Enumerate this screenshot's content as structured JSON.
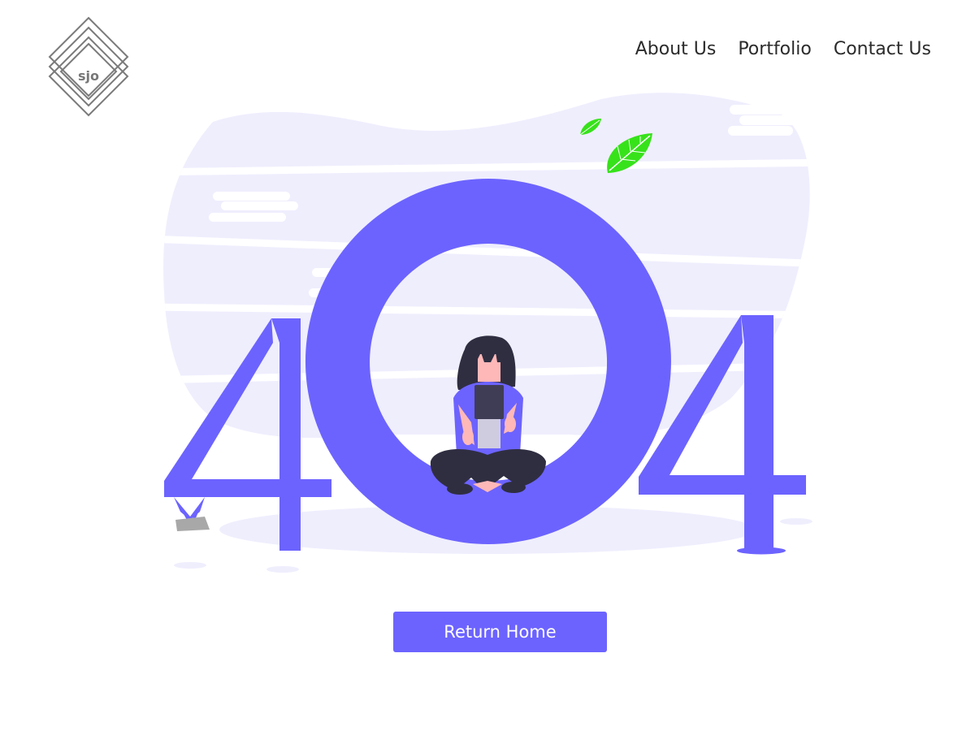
{
  "logo": {
    "text": "sjo",
    "icon": "diamond-logo-icon"
  },
  "nav": {
    "items": [
      {
        "label": "About Us"
      },
      {
        "label": "Portfolio"
      },
      {
        "label": "Contact Us"
      }
    ]
  },
  "error": {
    "code": "404",
    "illustration": "person-sitting-in-zero-icon"
  },
  "actions": {
    "return_home_label": "Return Home"
  },
  "colors": {
    "accent": "#6c63ff",
    "background_blob": "#efeefd",
    "leaf": "#37e21b",
    "text": "#2b2b2b"
  }
}
